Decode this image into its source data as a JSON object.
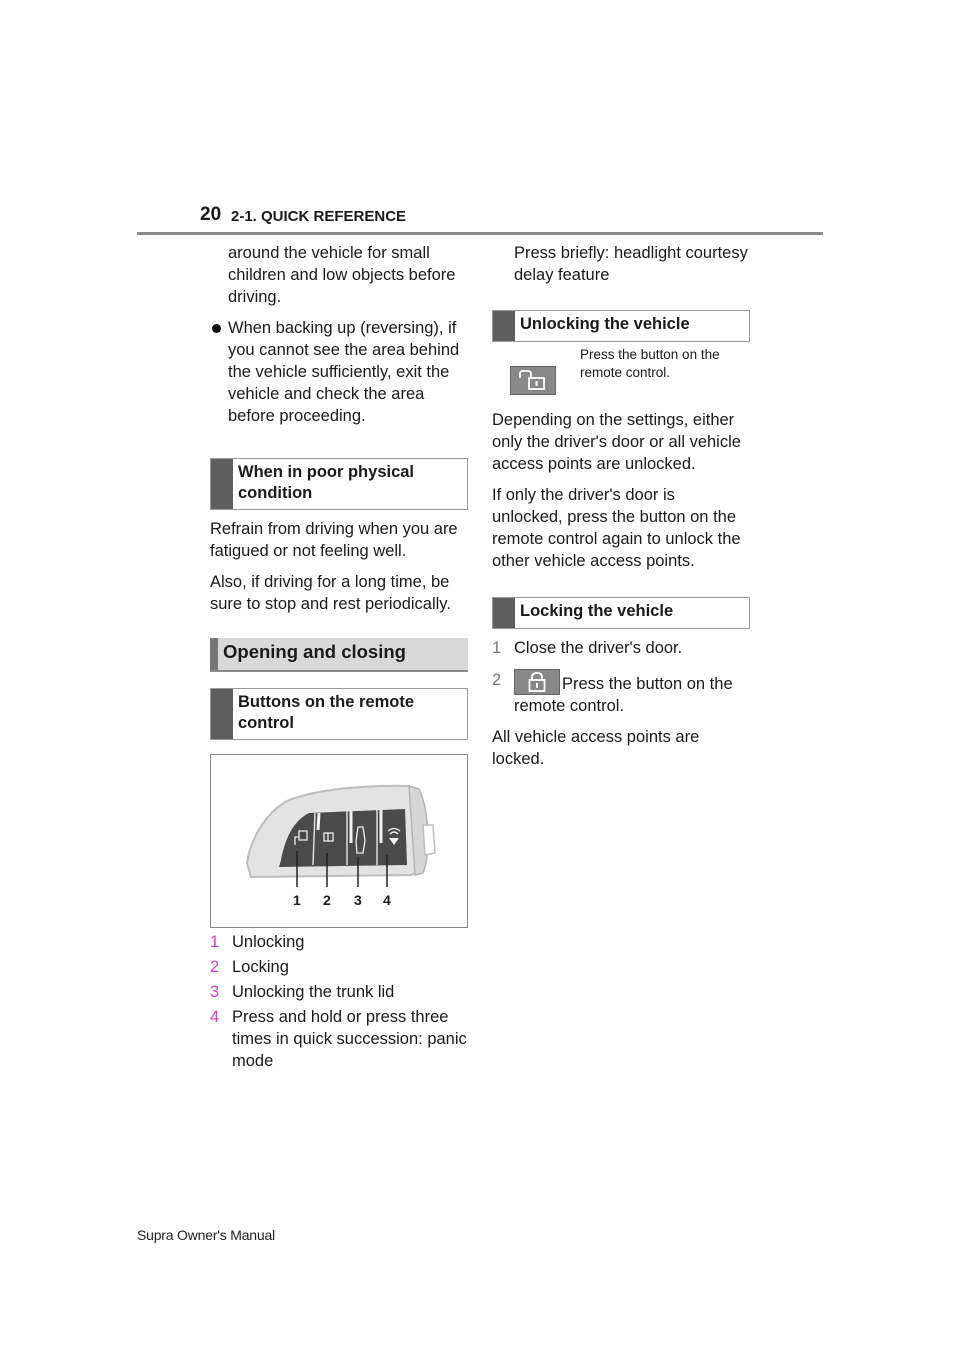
{
  "header": {
    "page_number": "20",
    "chapter": "2-1. QUICK REFERENCE"
  },
  "left_column": {
    "intro_continuation": "around the vehicle for small children and low objects before driving.",
    "bullet": "When backing up (reversing), if you cannot see the area behind the vehicle sufficiently, exit the vehicle and check the area before proceeding.",
    "subhead_physical": "When in poor physical condition",
    "para_refrain": "Refrain from driving when you are fatigued or not feeling well.",
    "para_also": "Also, if driving for a long time, be sure to stop and rest periodically.",
    "section_title": "Opening and closing",
    "subhead_buttons": "Buttons on the remote control",
    "figure": {
      "name": "remote-key-fob",
      "callouts": [
        "1",
        "2",
        "3",
        "4"
      ]
    },
    "buttons_list": [
      {
        "n": "1",
        "text": "Unlocking"
      },
      {
        "n": "2",
        "text": "Locking"
      },
      {
        "n": "3",
        "text": "Unlocking the trunk lid"
      },
      {
        "n": "4",
        "text": "Press and hold or press three times in quick succession: panic mode"
      }
    ]
  },
  "right_column": {
    "continuation": "Press briefly: headlight courtesy delay feature",
    "subhead_unlocking": "Unlocking the vehicle",
    "unlock_icon": "unlock-icon",
    "unlock_icon_text": "Press the button on the remote control.",
    "para_depending": "Depending on the settings, either only the driver's door or all vehicle access points are unlocked.",
    "para_if_only": "If only the driver's door is unlocked, press the button on the remote control again to unlock the other vehicle access points.",
    "subhead_locking": "Locking the vehicle",
    "steps": [
      {
        "n": "1",
        "text": "Close the driver's door."
      },
      {
        "n": "2",
        "icon": "lock-icon",
        "text": "Press the button on the remote control."
      }
    ],
    "para_all_locked": "All vehicle access points are locked."
  },
  "footer": {
    "title": "Supra Owner's Manual"
  },
  "colors": {
    "accent_number": "#d23fc9",
    "subhead_bar": "#5e5e5e",
    "section_bg": "#d9d9d9",
    "icon_box": "#888888"
  }
}
